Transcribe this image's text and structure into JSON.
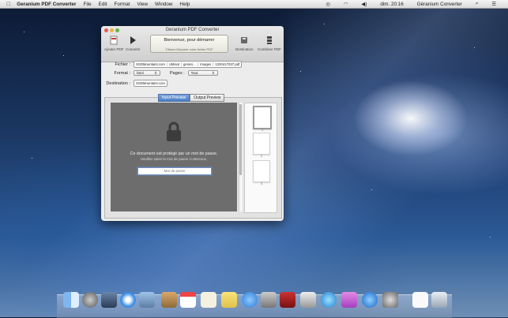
{
  "menubar": {
    "app_name": "Geranium PDF Converter",
    "items": [
      "File",
      "Edit",
      "Format",
      "View",
      "Window",
      "Help"
    ],
    "clock": "dim. 20:16",
    "user": "Géranium Converter"
  },
  "window": {
    "title": "Geranium PDF Converter",
    "toolbar": {
      "add_pdf": "Ajouter PDF",
      "convert": "Convertir",
      "destination": "Destination",
      "combine_pdf": "Combiner PDF"
    },
    "status": {
      "line1": "Bienvenue, pour démarrer",
      "line2": "Glisser-Déposer votre fichier PDF"
    },
    "fields": {
      "file_label": "Fichier :",
      "file_path": [
        "SSDMountaint.com",
        "Utilisat",
        "gerani…",
        "Images",
        "1330417037.pdf"
      ],
      "format_label": "Format :",
      "format_value": "html",
      "pages_label": "Pages :",
      "pages_value": "Tout",
      "destination_label": "Destination :",
      "destination_value": "SSDMountaint.com"
    },
    "tabs": {
      "input": "Input Preview",
      "output": "Output Preview"
    },
    "preview": {
      "message": "Ce document est protégé par un mot de passe.",
      "sub_message": "Veuillez saisir le mot de passe ci-dessous.",
      "password_placeholder": "Mot de passe"
    },
    "thumbnails": [
      "1",
      "2",
      "3"
    ]
  },
  "dock": {
    "icons": [
      "finder-icon",
      "rocket-icon",
      "mission-control-icon",
      "safari-icon",
      "preview-icon",
      "contacts-icon",
      "calendar-icon",
      "notes-icon",
      "stickies-icon",
      "messages-icon",
      "facetime-icon",
      "photo-booth-icon",
      "iphoto-icon",
      "itunes-icon",
      "pdf-converter-icon",
      "app-store-icon",
      "system-preferences-icon",
      "document-icon",
      "trash-icon"
    ]
  }
}
